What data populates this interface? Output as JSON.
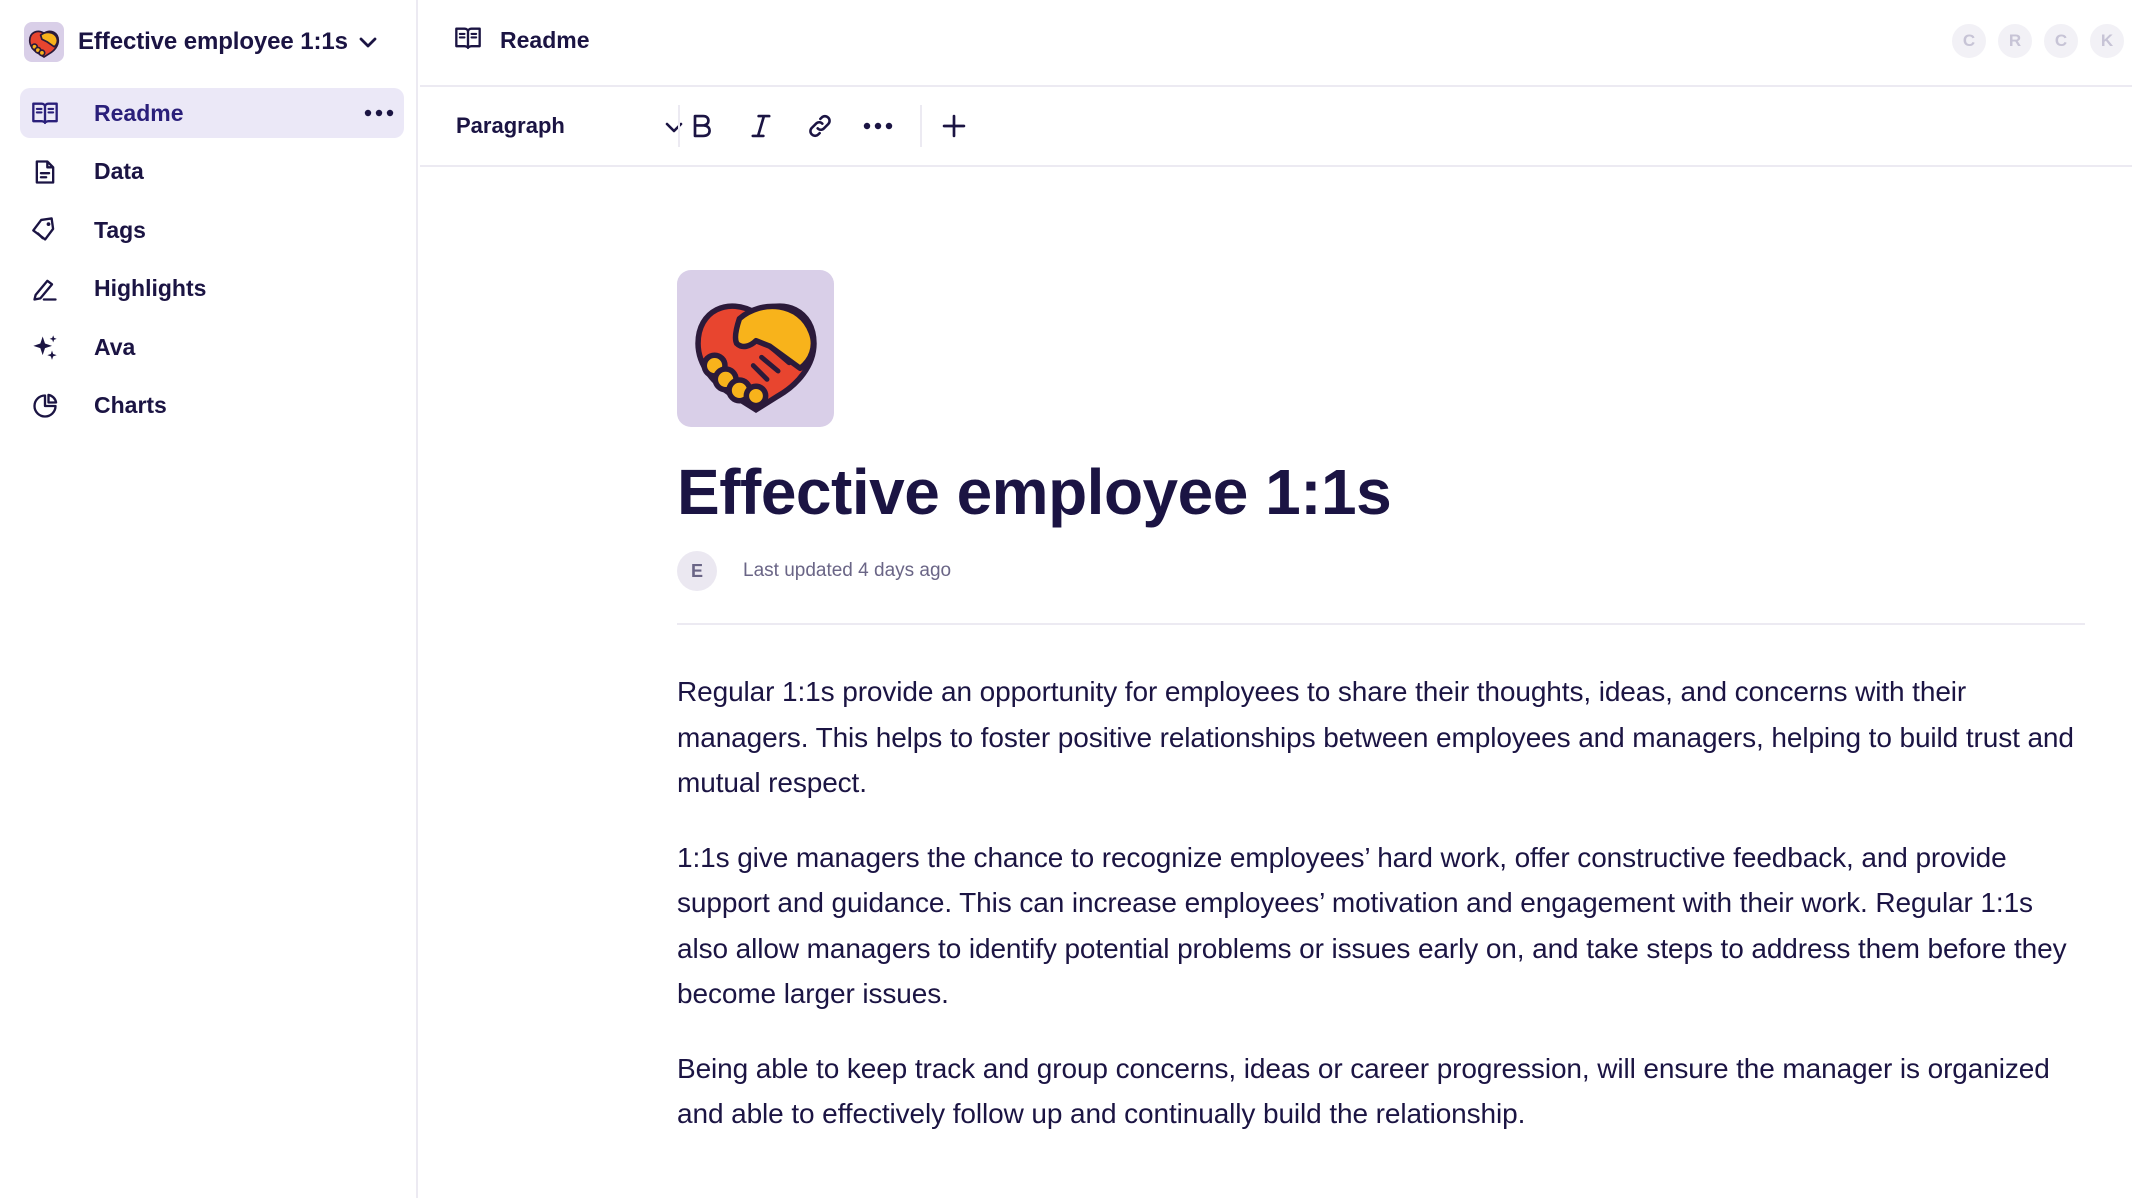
{
  "workspace": {
    "name": "Effective employee 1:1s",
    "logo_icon": "handshake-icon"
  },
  "sidebar": {
    "items": [
      {
        "label": "Readme",
        "icon": "book-open-icon",
        "active": true
      },
      {
        "label": "Data",
        "icon": "document-icon",
        "active": false
      },
      {
        "label": "Tags",
        "icon": "tags-icon",
        "active": false
      },
      {
        "label": "Highlights",
        "icon": "highlighter-pen-icon",
        "active": false
      },
      {
        "label": "Ava",
        "icon": "sparkles-icon",
        "active": false
      },
      {
        "label": "Charts",
        "icon": "pie-chart-icon",
        "active": false
      }
    ]
  },
  "topbar": {
    "title": "Readme",
    "title_icon": "book-open-icon",
    "avatars": [
      "C",
      "R",
      "C",
      "K"
    ]
  },
  "toolbar": {
    "block_type": "Paragraph",
    "buttons": [
      "bold-icon",
      "italic-icon",
      "link-icon",
      "more-icon",
      "plus-icon"
    ]
  },
  "document": {
    "title": "Effective employee 1:1s",
    "author_initial": "E",
    "last_updated": "Last updated 4 days ago",
    "paragraphs": [
      "Regular 1:1s provide an opportunity for employees to share their thoughts, ideas, and concerns with their managers. This helps to foster positive relationships between employees and managers, helping to build trust and mutual respect.",
      "1:1s give managers the chance to recognize employees’ hard work, offer constructive feedback, and provide support and guidance. This can increase employees’ motivation and engagement with their work. Regular 1:1s also allow managers to identify potential problems or issues early on, and take steps to address them before they become larger issues.",
      "Being able to keep track and group concerns, ideas or career progression, will ensure the manager is organized and able to effectively follow up and continually build the relationship."
    ]
  },
  "colors": {
    "text_primary": "#1b1443",
    "active_bg": "#ebe8f7",
    "icon_bg": "#d9cfe8",
    "muted_text": "#6a6586",
    "border": "#eceaf2"
  }
}
